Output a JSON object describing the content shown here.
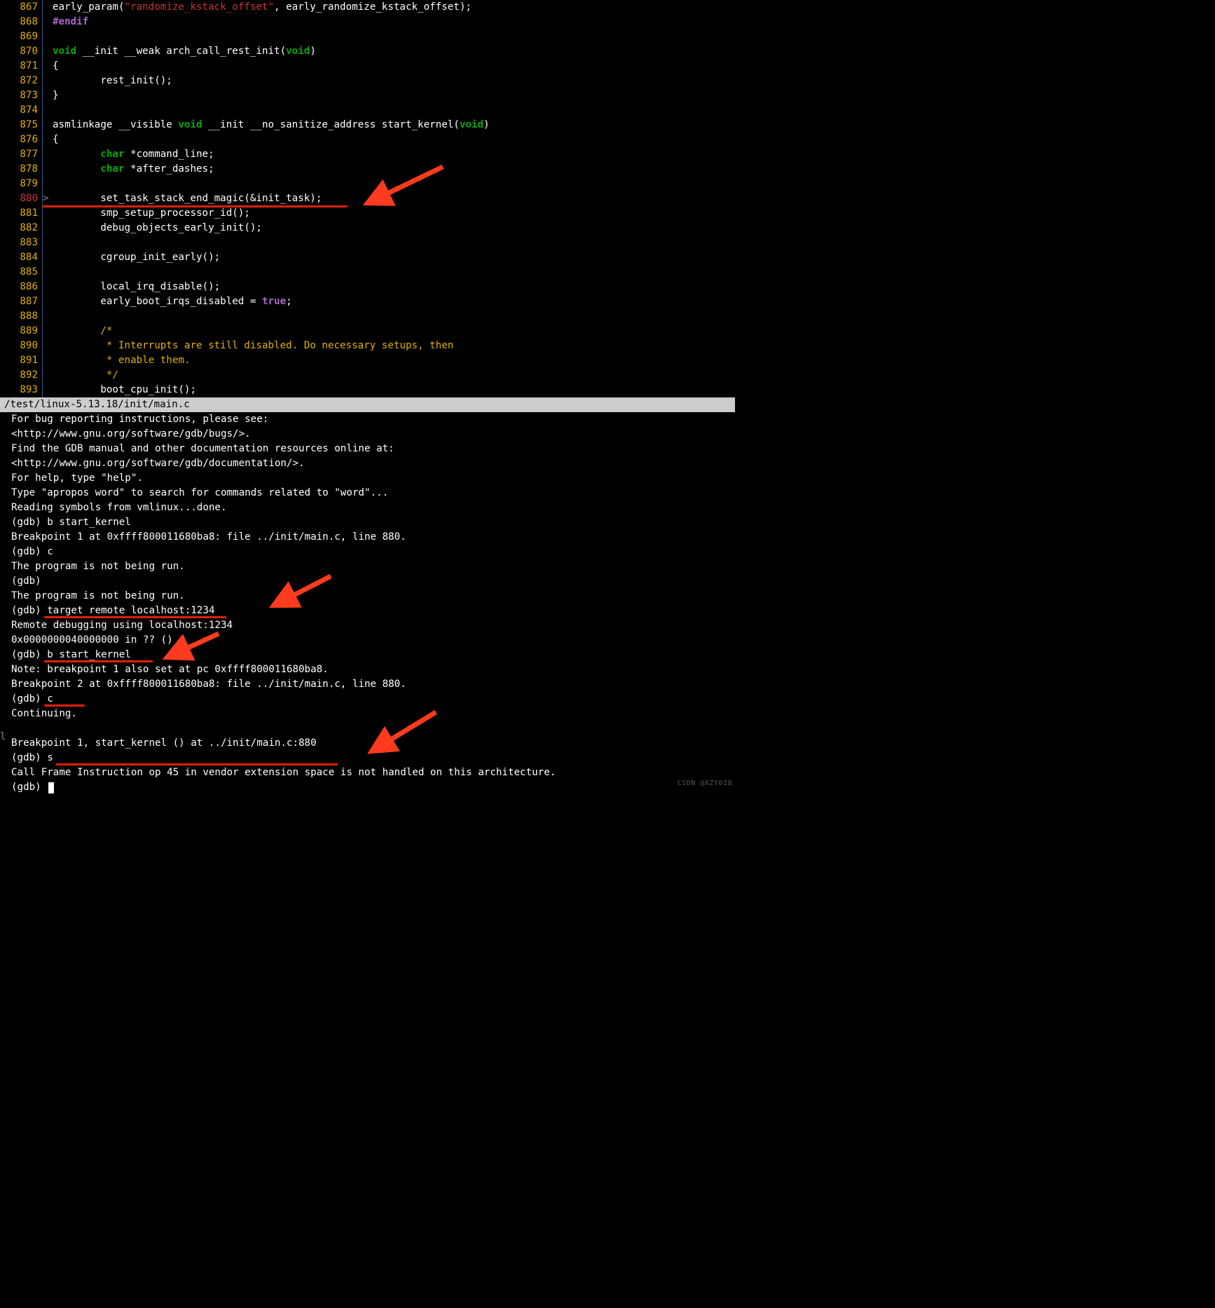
{
  "editor": {
    "file_path": "/test/linux-5.13.18/init/main.c",
    "current_line": "880",
    "breakpoint_marker": ">",
    "lines": [
      {
        "num": "867",
        "tokens": [
          {
            "c": "plain",
            "t": "early_param("
          },
          {
            "c": "str-red",
            "t": "\"randomize_kstack_offset\""
          },
          {
            "c": "plain",
            "t": ", early_randomize_kstack_offset);"
          }
        ]
      },
      {
        "num": "868",
        "tokens": [
          {
            "c": "dir-purple",
            "t": "#endif"
          }
        ]
      },
      {
        "num": "869",
        "tokens": []
      },
      {
        "num": "870",
        "tokens": [
          {
            "c": "kw-green",
            "t": "void"
          },
          {
            "c": "plain",
            "t": " __init __weak arch_call_rest_init("
          },
          {
            "c": "kw-green",
            "t": "void"
          },
          {
            "c": "plain",
            "t": ")"
          }
        ]
      },
      {
        "num": "871",
        "tokens": [
          {
            "c": "plain",
            "t": "{"
          }
        ]
      },
      {
        "num": "872",
        "tokens": [
          {
            "c": "plain",
            "t": "        rest_init();"
          }
        ]
      },
      {
        "num": "873",
        "tokens": [
          {
            "c": "plain",
            "t": "}"
          }
        ]
      },
      {
        "num": "874",
        "tokens": []
      },
      {
        "num": "875",
        "tokens": [
          {
            "c": "plain",
            "t": "asmlinkage __visible "
          },
          {
            "c": "kw-green",
            "t": "void"
          },
          {
            "c": "plain",
            "t": " __init __no_sanitize_address start_kernel("
          },
          {
            "c": "kw-green",
            "t": "void"
          },
          {
            "c": "plain",
            "t": ")"
          }
        ]
      },
      {
        "num": "876",
        "tokens": [
          {
            "c": "plain",
            "t": "{"
          }
        ]
      },
      {
        "num": "877",
        "tokens": [
          {
            "c": "plain",
            "t": "        "
          },
          {
            "c": "kw-green",
            "t": "char"
          },
          {
            "c": "plain",
            "t": " *command_line;"
          }
        ]
      },
      {
        "num": "878",
        "tokens": [
          {
            "c": "plain",
            "t": "        "
          },
          {
            "c": "kw-green",
            "t": "char"
          },
          {
            "c": "plain",
            "t": " *after_dashes;"
          }
        ]
      },
      {
        "num": "879",
        "tokens": []
      },
      {
        "num": "880",
        "tokens": [
          {
            "c": "plain",
            "t": "        set_task_stack_end_magic(&init_task);"
          }
        ],
        "current": true
      },
      {
        "num": "881",
        "tokens": [
          {
            "c": "plain",
            "t": "        smp_setup_processor_id();"
          }
        ]
      },
      {
        "num": "882",
        "tokens": [
          {
            "c": "plain",
            "t": "        debug_objects_early_init();"
          }
        ]
      },
      {
        "num": "883",
        "tokens": []
      },
      {
        "num": "884",
        "tokens": [
          {
            "c": "plain",
            "t": "        cgroup_init_early();"
          }
        ]
      },
      {
        "num": "885",
        "tokens": []
      },
      {
        "num": "886",
        "tokens": [
          {
            "c": "plain",
            "t": "        local_irq_disable();"
          }
        ]
      },
      {
        "num": "887",
        "tokens": [
          {
            "c": "plain",
            "t": "        early_boot_irqs_disabled = "
          },
          {
            "c": "bool-purple",
            "t": "true"
          },
          {
            "c": "plain",
            "t": ";"
          }
        ]
      },
      {
        "num": "888",
        "tokens": []
      },
      {
        "num": "889",
        "tokens": [
          {
            "c": "plain",
            "t": "        "
          },
          {
            "c": "comment-yellow",
            "t": "/*"
          }
        ]
      },
      {
        "num": "890",
        "tokens": [
          {
            "c": "comment-yellow",
            "t": "         * Interrupts are still disabled. Do necessary setups, then"
          }
        ]
      },
      {
        "num": "891",
        "tokens": [
          {
            "c": "comment-yellow",
            "t": "         * enable them."
          }
        ]
      },
      {
        "num": "892",
        "tokens": [
          {
            "c": "comment-yellow",
            "t": "         */"
          }
        ]
      },
      {
        "num": "893",
        "tokens": [
          {
            "c": "plain",
            "t": "        boot_cpu_init();"
          }
        ]
      }
    ]
  },
  "terminal": {
    "lines": [
      "For bug reporting instructions, please see:",
      "<http://www.gnu.org/software/gdb/bugs/>.",
      "Find the GDB manual and other documentation resources online at:",
      "<http://www.gnu.org/software/gdb/documentation/>.",
      "For help, type \"help\".",
      "Type \"apropos word\" to search for commands related to \"word\"...",
      "Reading symbols from vmlinux...done.",
      "(gdb) b start_kernel",
      "Breakpoint 1 at 0xffff800011680ba8: file ../init/main.c, line 880.",
      "(gdb) c",
      "The program is not being run.",
      "(gdb)",
      "The program is not being run.",
      "(gdb) target remote localhost:1234",
      "Remote debugging using localhost:1234",
      "0x0000000040000000 in ?? ()",
      "(gdb) b start_kernel",
      "Note: breakpoint 1 also set at pc 0xffff800011680ba8.",
      "Breakpoint 2 at 0xffff800011680ba8: file ../init/main.c, line 880.",
      "(gdb) c",
      "Continuing.",
      "",
      "Breakpoint 1, start_kernel () at ../init/main.c:880",
      "(gdb) s",
      "Call Frame Instruction op 45 in vendor extension space is not handled on this architecture.",
      "(gdb) "
    ],
    "cursor_line": 25
  },
  "watermark": "CSDN @XZY028",
  "left_char": "l"
}
